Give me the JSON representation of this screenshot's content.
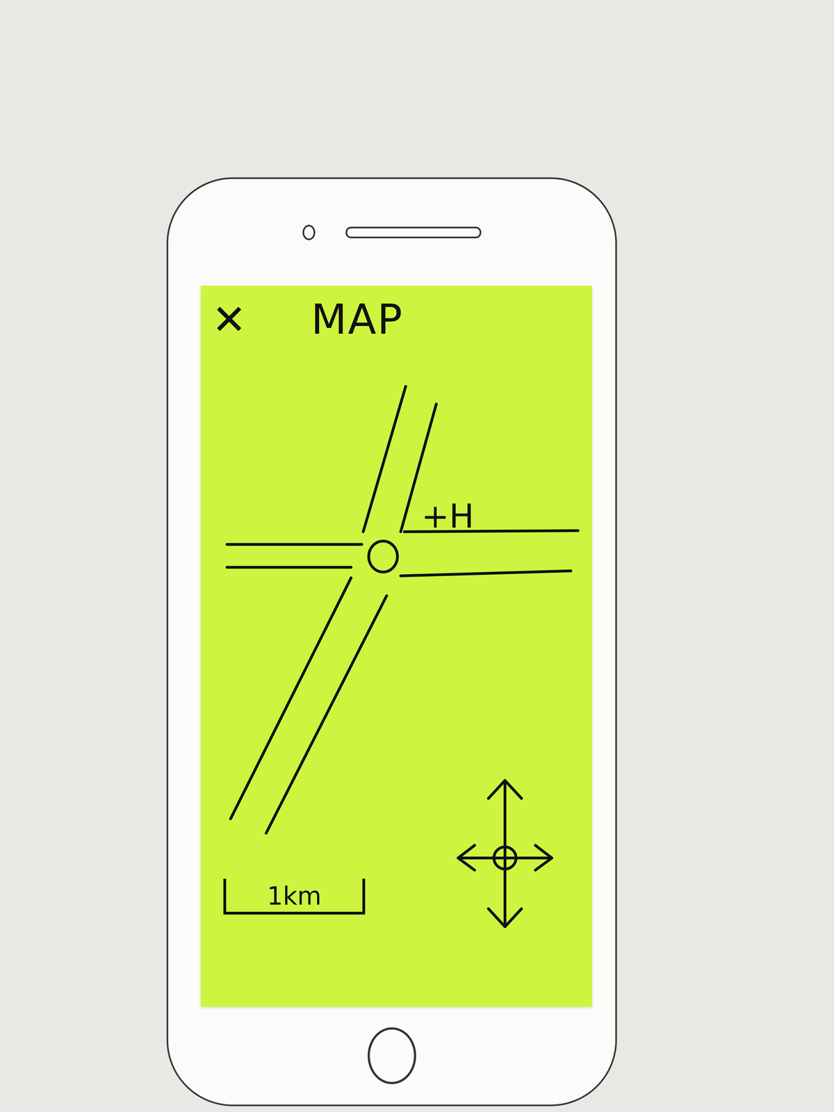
{
  "header": {
    "close": "✕",
    "title": "MAP"
  },
  "map": {
    "markers": [
      {
        "label": "+H"
      }
    ],
    "scale": "1km"
  }
}
